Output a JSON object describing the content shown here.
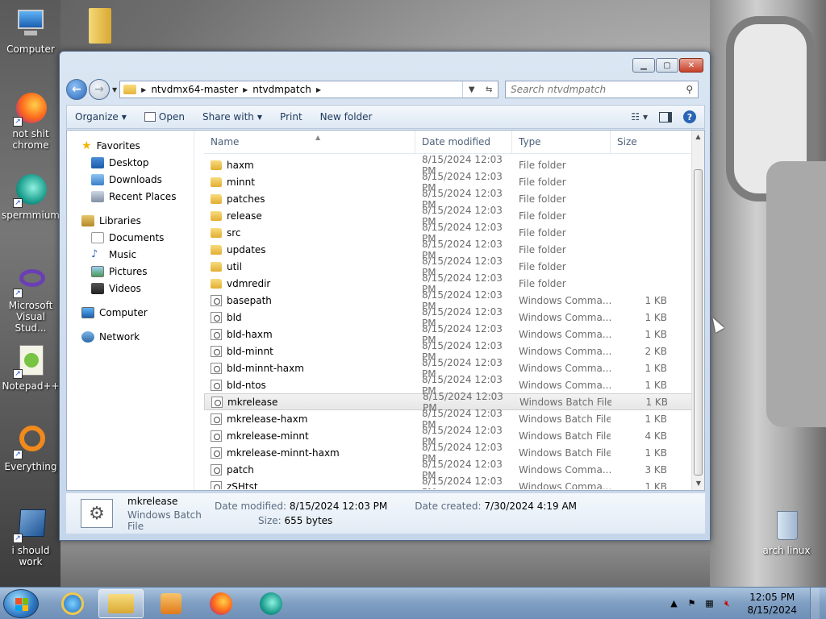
{
  "desktop": {
    "icons_left": [
      {
        "label": "Computer",
        "icon": "computer-icon"
      },
      {
        "label": "not shit chrome",
        "icon": "firefox-icon"
      },
      {
        "label": "spermmium",
        "icon": "browser-icon"
      },
      {
        "label": "Microsoft Visual Stud...",
        "icon": "visual-studio-icon"
      },
      {
        "label": "Notepad++",
        "icon": "notepad-icon"
      },
      {
        "label": "Everything",
        "icon": "everything-icon"
      },
      {
        "label": "i should work",
        "icon": "virtualbox-icon"
      }
    ],
    "icon_right": {
      "label": "arch linux",
      "icon": "recycle-bin-icon"
    }
  },
  "window": {
    "address": {
      "crumbs": [
        "ntvdmx64-master",
        "ntvdmpatch"
      ]
    },
    "search_placeholder": "Search ntvdmpatch",
    "toolbar": {
      "organize": "Organize",
      "open": "Open",
      "share_with": "Share with",
      "print": "Print",
      "new_folder": "New folder"
    },
    "nav_pane": {
      "favorites": {
        "label": "Favorites",
        "items": [
          "Desktop",
          "Downloads",
          "Recent Places"
        ]
      },
      "libraries": {
        "label": "Libraries",
        "items": [
          "Documents",
          "Music",
          "Pictures",
          "Videos"
        ]
      },
      "computer": "Computer",
      "network": "Network"
    },
    "columns": [
      "Name",
      "Date modified",
      "Type",
      "Size"
    ],
    "files": [
      {
        "name": "haxm",
        "date": "8/15/2024 12:03 PM",
        "type": "File folder",
        "size": "",
        "kind": "folder"
      },
      {
        "name": "minnt",
        "date": "8/15/2024 12:03 PM",
        "type": "File folder",
        "size": "",
        "kind": "folder"
      },
      {
        "name": "patches",
        "date": "8/15/2024 12:03 PM",
        "type": "File folder",
        "size": "",
        "kind": "folder"
      },
      {
        "name": "release",
        "date": "8/15/2024 12:03 PM",
        "type": "File folder",
        "size": "",
        "kind": "folder"
      },
      {
        "name": "src",
        "date": "8/15/2024 12:03 PM",
        "type": "File folder",
        "size": "",
        "kind": "folder"
      },
      {
        "name": "updates",
        "date": "8/15/2024 12:03 PM",
        "type": "File folder",
        "size": "",
        "kind": "folder"
      },
      {
        "name": "util",
        "date": "8/15/2024 12:03 PM",
        "type": "File folder",
        "size": "",
        "kind": "folder"
      },
      {
        "name": "vdmredir",
        "date": "8/15/2024 12:03 PM",
        "type": "File folder",
        "size": "",
        "kind": "folder"
      },
      {
        "name": "basepath",
        "date": "8/15/2024 12:03 PM",
        "type": "Windows Comma...",
        "size": "1 KB",
        "kind": "bat"
      },
      {
        "name": "bld",
        "date": "8/15/2024 12:03 PM",
        "type": "Windows Comma...",
        "size": "1 KB",
        "kind": "bat"
      },
      {
        "name": "bld-haxm",
        "date": "8/15/2024 12:03 PM",
        "type": "Windows Comma...",
        "size": "1 KB",
        "kind": "bat"
      },
      {
        "name": "bld-minnt",
        "date": "8/15/2024 12:03 PM",
        "type": "Windows Comma...",
        "size": "2 KB",
        "kind": "bat"
      },
      {
        "name": "bld-minnt-haxm",
        "date": "8/15/2024 12:03 PM",
        "type": "Windows Comma...",
        "size": "1 KB",
        "kind": "bat"
      },
      {
        "name": "bld-ntos",
        "date": "8/15/2024 12:03 PM",
        "type": "Windows Comma...",
        "size": "1 KB",
        "kind": "bat"
      },
      {
        "name": "mkrelease",
        "date": "8/15/2024 12:03 PM",
        "type": "Windows Batch File",
        "size": "1 KB",
        "kind": "bat",
        "selected": true
      },
      {
        "name": "mkrelease-haxm",
        "date": "8/15/2024 12:03 PM",
        "type": "Windows Batch File",
        "size": "1 KB",
        "kind": "bat"
      },
      {
        "name": "mkrelease-minnt",
        "date": "8/15/2024 12:03 PM",
        "type": "Windows Batch File",
        "size": "4 KB",
        "kind": "bat"
      },
      {
        "name": "mkrelease-minnt-haxm",
        "date": "8/15/2024 12:03 PM",
        "type": "Windows Batch File",
        "size": "1 KB",
        "kind": "bat"
      },
      {
        "name": "patch",
        "date": "8/15/2024 12:03 PM",
        "type": "Windows Comma...",
        "size": "3 KB",
        "kind": "bat"
      },
      {
        "name": "zSHtst",
        "date": "8/15/2024 12:03 PM",
        "type": "Windows Comma...",
        "size": "1 KB",
        "kind": "bat"
      }
    ],
    "details": {
      "name": "mkrelease",
      "type": "Windows Batch File",
      "date_modified_label": "Date modified:",
      "date_modified": "8/15/2024 12:03 PM",
      "date_created_label": "Date created:",
      "date_created": "7/30/2024 4:19 AM",
      "size_label": "Size:",
      "size": "655 bytes"
    }
  },
  "taskbar": {
    "clock_time": "12:05 PM",
    "clock_date": "8/15/2024"
  },
  "colors": {
    "accent": "#2a67b8",
    "window_frame": "#c6d6ea",
    "folder": "#e5b53b",
    "close_button": "#c7402a"
  }
}
